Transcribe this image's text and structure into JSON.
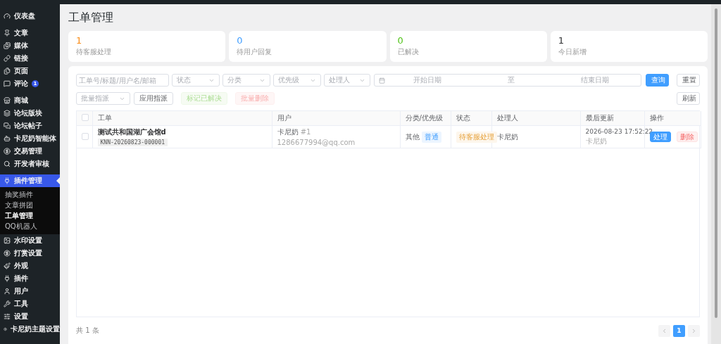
{
  "page_title": "工单管理",
  "sidebar": {
    "groups": [
      [
        {
          "label": "仪表盘",
          "selected": false
        }
      ],
      [
        {
          "label": "文章",
          "selected": false
        },
        {
          "label": "媒体",
          "selected": false
        },
        {
          "label": "链接",
          "selected": false
        },
        {
          "label": "页面",
          "selected": false
        },
        {
          "label": "评论",
          "selected": false,
          "badge": "1"
        }
      ],
      [
        {
          "label": "商城",
          "selected": false
        },
        {
          "label": "论坛版块",
          "selected": false
        },
        {
          "label": "论坛帖子",
          "selected": false
        },
        {
          "label": "卡尼奶智能体",
          "selected": false
        },
        {
          "label": "交易管理",
          "selected": false
        },
        {
          "label": "开发者审核",
          "selected": false
        }
      ],
      [
        {
          "label": "插件管理",
          "selected": true,
          "children": [
            {
              "label": "抽奖插件",
              "selected": false
            },
            {
              "label": "文章拼团",
              "selected": false
            },
            {
              "label": "工单管理",
              "selected": true
            },
            {
              "label": "QQ机器人",
              "selected": false
            }
          ]
        },
        {
          "label": "水印设置",
          "selected": false
        },
        {
          "label": "打赏设置",
          "selected": false
        },
        {
          "label": "外观",
          "selected": false
        },
        {
          "label": "插件",
          "selected": false
        },
        {
          "label": "用户",
          "selected": false
        },
        {
          "label": "工具",
          "selected": false
        },
        {
          "label": "设置",
          "selected": false
        },
        {
          "label": "卡尼奶主题设置",
          "selected": false
        }
      ]
    ]
  },
  "stats": [
    {
      "value": "1",
      "label": "待客服处理",
      "color": "#fa8c16"
    },
    {
      "value": "0",
      "label": "待用户回复",
      "color": "#409eff"
    },
    {
      "value": "0",
      "label": "已解决",
      "color": "#52c41a"
    },
    {
      "value": "1",
      "label": "今日新增",
      "color": "#303133"
    }
  ],
  "filters": {
    "search": {
      "placeholder": "工单号/标题/用户名/邮箱"
    },
    "selects": [
      {
        "placeholder": "状态"
      },
      {
        "placeholder": "分类"
      },
      {
        "placeholder": "优先级"
      },
      {
        "placeholder": "处理人"
      }
    ],
    "date_range": {
      "start_placeholder": "开始日期",
      "separator": "至",
      "end_placeholder": "结束日期"
    },
    "buttons": [
      {
        "label": "查询",
        "kind": "primary"
      },
      {
        "label": "重置",
        "kind": "default"
      }
    ]
  },
  "bulk": {
    "select": {
      "placeholder": "批量指派"
    },
    "buttons": [
      {
        "label": "应用指派",
        "kind": "default",
        "disabled": false
      },
      {
        "label": "标记已解决",
        "kind": "success",
        "disabled": true
      },
      {
        "label": "批量删除",
        "kind": "danger",
        "disabled": true
      }
    ],
    "refresh": "刷新"
  },
  "table": {
    "all_checked": false,
    "columns": [
      "工单",
      "用户",
      "分类/优先级",
      "状态",
      "处理人",
      "最后更新",
      "操作"
    ],
    "rows": [
      {
        "checked": false,
        "title": "测试共和国湖广会馆d",
        "ticket_no": "KNN-20260823-000001",
        "user_name": "卡尼奶",
        "user_id": "#1",
        "email": "1286677994@qq.com",
        "category": "其他",
        "priority": "普通",
        "status": "待客服处理",
        "assignee": "卡尼奶",
        "updated": "2026-08-23 17:52:22",
        "updated_by": "卡尼奶",
        "actions": [
          {
            "label": "处理",
            "kind": "primary"
          },
          {
            "label": "删除",
            "kind": "danger"
          }
        ]
      }
    ]
  },
  "pagination": {
    "total": "共 1 条",
    "pages": [
      {
        "label": "1",
        "selected": true
      }
    ]
  }
}
